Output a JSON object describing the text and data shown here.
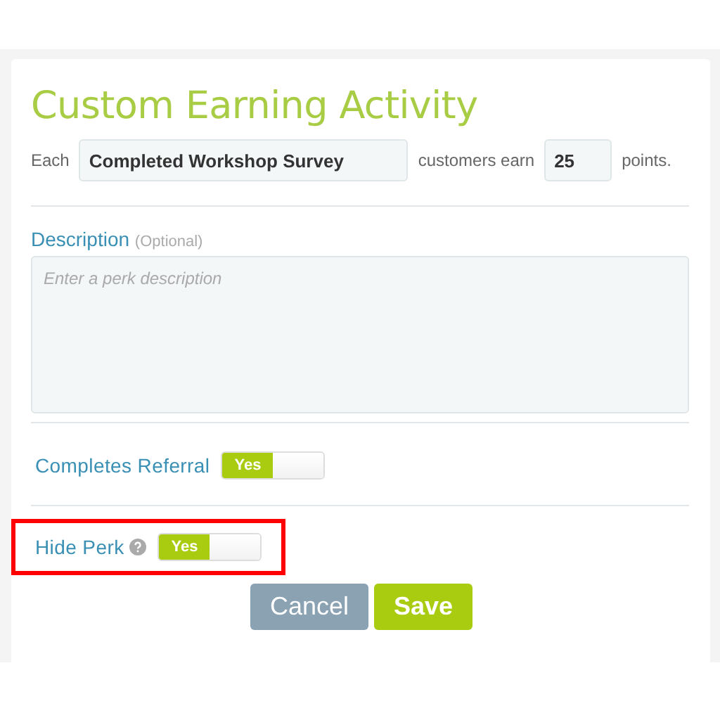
{
  "title": "Custom Earning Activity",
  "earn_row": {
    "prefix": "Each",
    "activity_value": "Completed Workshop Survey",
    "middle": "customers earn",
    "points_value": "25",
    "suffix": "points."
  },
  "description": {
    "label": "Description",
    "hint": "(Optional)",
    "placeholder": "Enter a perk description"
  },
  "toggles": [
    {
      "label": "Completes Referral",
      "on": true,
      "state_text": "Yes",
      "help": false,
      "highlighted": false
    },
    {
      "label": "Hide Perk",
      "on": true,
      "state_text": "Yes",
      "help": true,
      "highlighted": true
    }
  ],
  "buttons": [
    {
      "label": "Cancel",
      "kind": "secondary"
    },
    {
      "label": "Save",
      "kind": "primary"
    }
  ]
}
